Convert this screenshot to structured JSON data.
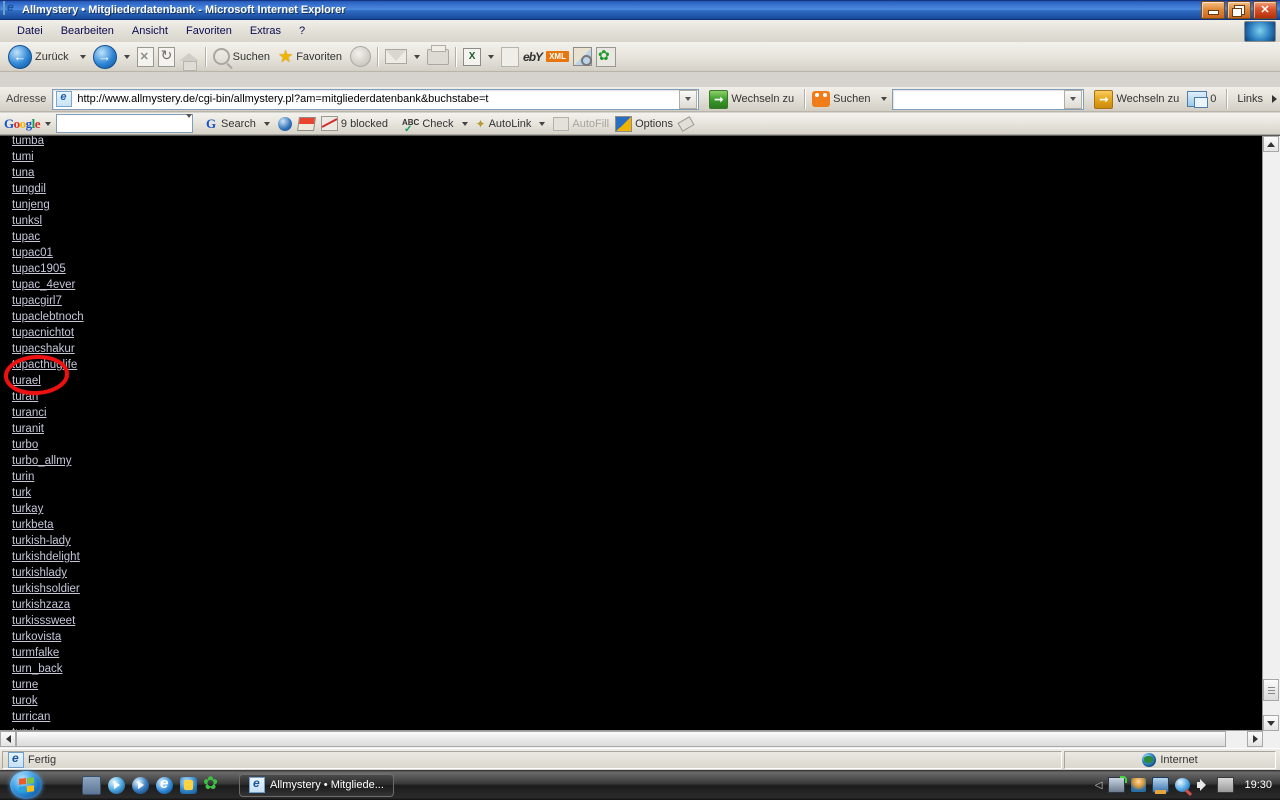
{
  "window": {
    "title": "Allmystery • Mitgliederdatenbank - Microsoft Internet Explorer",
    "minimize_label": "Minimieren",
    "maximize_label": "Maximieren",
    "close_label": "Schließen"
  },
  "menubar": {
    "items": [
      {
        "label": "Datei"
      },
      {
        "label": "Bearbeiten"
      },
      {
        "label": "Ansicht"
      },
      {
        "label": "Favoriten"
      },
      {
        "label": "Extras"
      },
      {
        "label": "?"
      }
    ]
  },
  "toolbar": {
    "back_label": "Zurück",
    "forward_label": "",
    "stop_label": "",
    "refresh_label": "",
    "home_label": "",
    "search_label": "Suchen",
    "favorites_label": "Favoriten",
    "xml_badge": "XML",
    "ebay_label": "ebY"
  },
  "addressbar": {
    "label": "Adresse",
    "url": "http://www.allmystery.de/cgi-bin/allmystery.pl?am=mitgliederdatenbank&buchstabe=t",
    "go_label": "Wechseln zu",
    "search_label": "Suchen",
    "search_value": "",
    "search_placeholder": "",
    "search_go_label": "Wechseln zu",
    "window_count": "0",
    "links_label": "Links"
  },
  "googlebar": {
    "logo": "Google",
    "query": "",
    "search_label": "Search",
    "blocked_label": "9 blocked",
    "check_label": "Check",
    "autolink_label": "AutoLink",
    "autofill_label": "AutoFill",
    "options_label": "Options"
  },
  "page": {
    "background_color": "#000000",
    "link_color": "#c6c6da",
    "annotation": {
      "shape": "ellipse",
      "color": "#ee1111",
      "target": "tupac"
    },
    "links": [
      "tumba",
      "tumi",
      "tuna",
      "tungdil",
      "tunjeng",
      "tunksl",
      "tupac",
      "tupac01",
      "tupac1905",
      "tupac_4ever",
      "tupacgirl7",
      "tupaclebtnoch",
      "tupacnichtot",
      "tupacshakur",
      "tupacthuglife",
      "turael",
      "turan",
      "turanci",
      "turanit",
      "turbo",
      "turbo_allmy",
      "turin",
      "turk",
      "turkay",
      "turkbeta",
      "turkish-lady",
      "turkishdelight",
      "turkishlady",
      "turkishsoldier",
      "turkishzaza",
      "turkisssweet",
      "turkovista",
      "turmfalke",
      "turn_back",
      "turne",
      "turok",
      "turrican",
      "turuk"
    ]
  },
  "statusbar": {
    "status_text": "Fertig",
    "zone_text": "Internet"
  },
  "taskbar": {
    "start_label": "Start",
    "quick_launch": [
      "show-desktop-icon",
      "media-player-icon",
      "media-player-2-icon",
      "internet-explorer-icon",
      "messenger-icon",
      "icq-icon"
    ],
    "tasks": [
      {
        "label": "Allmystery • Mitgliede..."
      }
    ],
    "clock": "19:30"
  }
}
